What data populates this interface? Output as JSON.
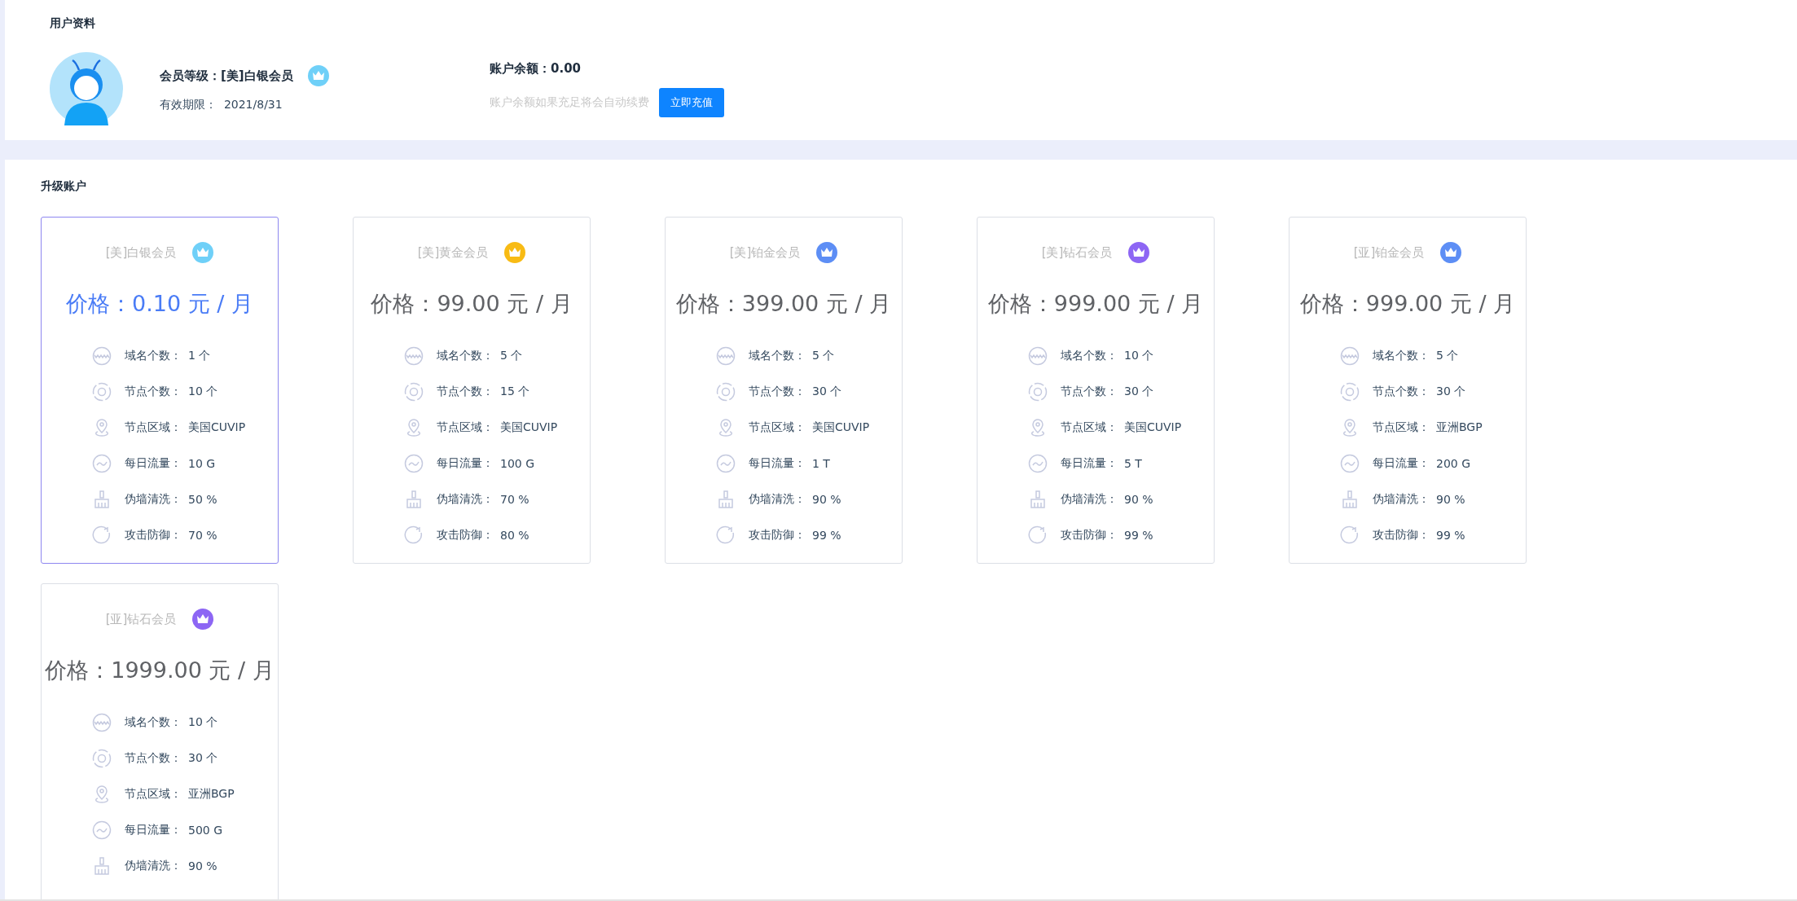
{
  "profile": {
    "title": "用户资料",
    "level_label": "会员等级：",
    "level_value": "[美]白银会员",
    "expiry_label": "有效期限：",
    "expiry_value": "2021/8/31",
    "balance_label": "账户余额：",
    "balance_value": "0.00",
    "hint": "账户余额如果充足将会自动续费",
    "recharge_button": "立即充值"
  },
  "upgrade": {
    "title": "升级账户",
    "plans": [
      {
        "name": "[美]白银会员",
        "color": "#6fd0f8",
        "price": "价格：0.10 元 / 月",
        "selected": true,
        "features": [
          {
            "kind": "domain",
            "label": "域名个数：",
            "value": "1 个"
          },
          {
            "kind": "node",
            "label": "节点个数：",
            "value": "10 个"
          },
          {
            "kind": "region",
            "label": "节点区域：",
            "value": "美国CUVIP"
          },
          {
            "kind": "traffic",
            "label": "每日流量：",
            "value": "10 G"
          },
          {
            "kind": "clean",
            "label": "伪墙清洗：",
            "value": "50 %"
          },
          {
            "kind": "defense",
            "label": "攻击防御：",
            "value": "70 %"
          }
        ]
      },
      {
        "name": "[美]黄金会员",
        "color": "#f8bb14",
        "price": "价格：99.00 元 / 月",
        "selected": false,
        "features": [
          {
            "kind": "domain",
            "label": "域名个数：",
            "value": "5 个"
          },
          {
            "kind": "node",
            "label": "节点个数：",
            "value": "15 个"
          },
          {
            "kind": "region",
            "label": "节点区域：",
            "value": "美国CUVIP"
          },
          {
            "kind": "traffic",
            "label": "每日流量：",
            "value": "100 G"
          },
          {
            "kind": "clean",
            "label": "伪墙清洗：",
            "value": "70 %"
          },
          {
            "kind": "defense",
            "label": "攻击防御：",
            "value": "80 %"
          }
        ]
      },
      {
        "name": "[美]铂金会员",
        "color": "#5d8ef5",
        "price": "价格：399.00 元 / 月",
        "selected": false,
        "features": [
          {
            "kind": "domain",
            "label": "域名个数：",
            "value": "5 个"
          },
          {
            "kind": "node",
            "label": "节点个数：",
            "value": "30 个"
          },
          {
            "kind": "region",
            "label": "节点区域：",
            "value": "美国CUVIP"
          },
          {
            "kind": "traffic",
            "label": "每日流量：",
            "value": "1 T"
          },
          {
            "kind": "clean",
            "label": "伪墙清洗：",
            "value": "90 %"
          },
          {
            "kind": "defense",
            "label": "攻击防御：",
            "value": "99 %"
          }
        ]
      },
      {
        "name": "[美]钻石会员",
        "color": "#8d66f4",
        "price": "价格：999.00 元 / 月",
        "selected": false,
        "features": [
          {
            "kind": "domain",
            "label": "域名个数：",
            "value": "10 个"
          },
          {
            "kind": "node",
            "label": "节点个数：",
            "value": "30 个"
          },
          {
            "kind": "region",
            "label": "节点区域：",
            "value": "美国CUVIP"
          },
          {
            "kind": "traffic",
            "label": "每日流量：",
            "value": "5 T"
          },
          {
            "kind": "clean",
            "label": "伪墙清洗：",
            "value": "90 %"
          },
          {
            "kind": "defense",
            "label": "攻击防御：",
            "value": "99 %"
          }
        ]
      },
      {
        "name": "[亚]铂金会员",
        "color": "#5d8ef5",
        "price": "价格：999.00 元 / 月",
        "selected": false,
        "features": [
          {
            "kind": "domain",
            "label": "域名个数：",
            "value": "5 个"
          },
          {
            "kind": "node",
            "label": "节点个数：",
            "value": "30 个"
          },
          {
            "kind": "region",
            "label": "节点区域：",
            "value": "亚洲BGP"
          },
          {
            "kind": "traffic",
            "label": "每日流量：",
            "value": "200 G"
          },
          {
            "kind": "clean",
            "label": "伪墙清洗：",
            "value": "90 %"
          },
          {
            "kind": "defense",
            "label": "攻击防御：",
            "value": "99 %"
          }
        ]
      },
      {
        "name": "[亚]钻石会员",
        "color": "#8d66f4",
        "price": "价格：1999.00 元 / 月",
        "selected": false,
        "features": [
          {
            "kind": "domain",
            "label": "域名个数：",
            "value": "10 个"
          },
          {
            "kind": "node",
            "label": "节点个数：",
            "value": "30 个"
          },
          {
            "kind": "region",
            "label": "节点区域：",
            "value": "亚洲BGP"
          },
          {
            "kind": "traffic",
            "label": "每日流量：",
            "value": "500 G"
          },
          {
            "kind": "clean",
            "label": "伪墙清洗：",
            "value": "90 %"
          }
        ]
      }
    ]
  }
}
